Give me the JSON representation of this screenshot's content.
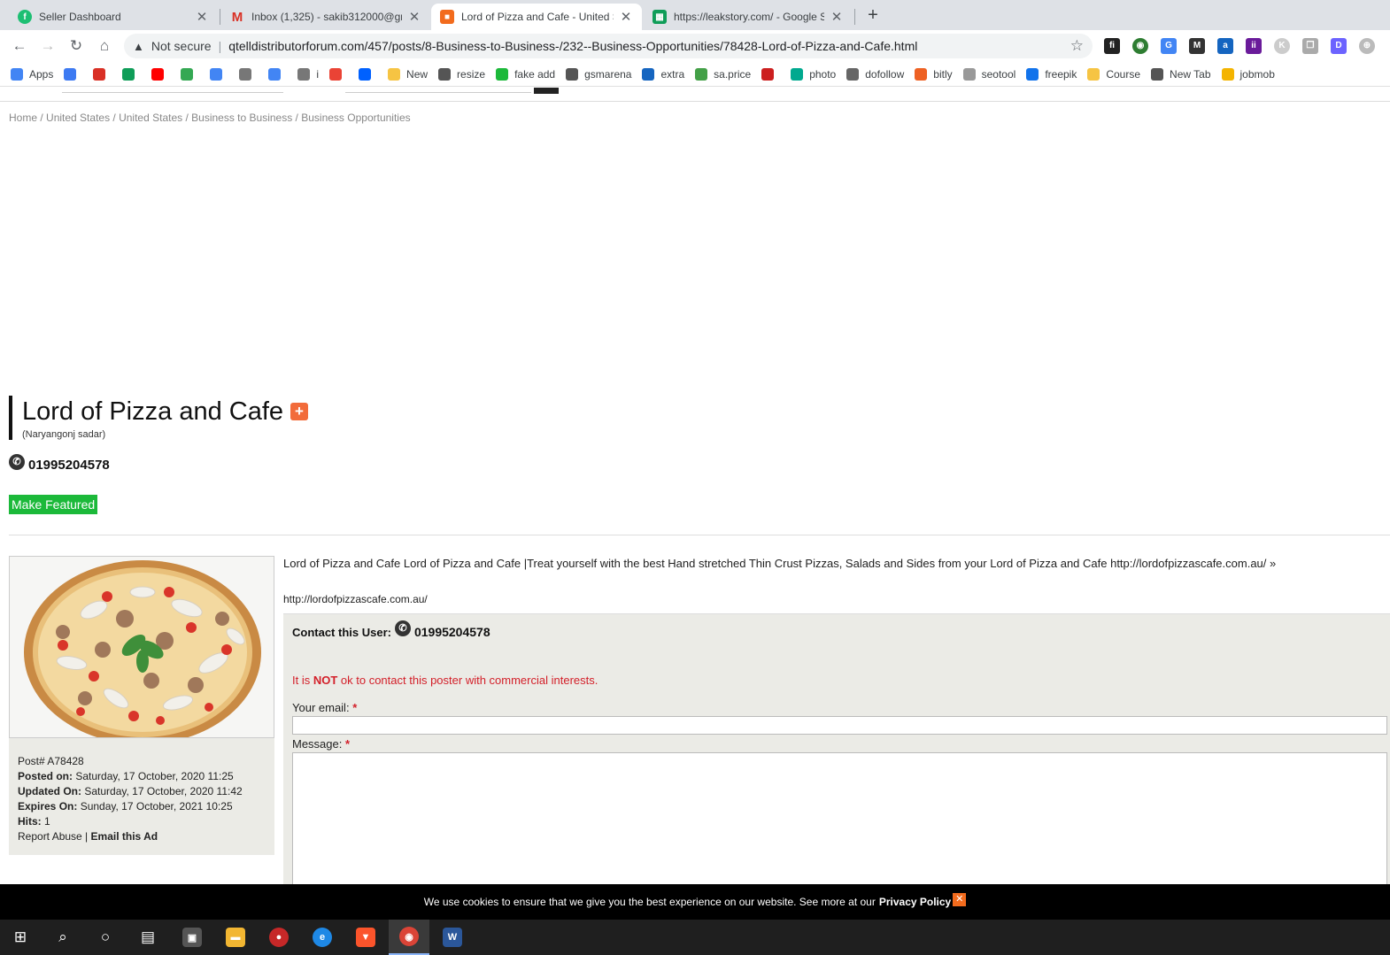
{
  "tabs": [
    {
      "title": "Seller Dashboard",
      "icon": "fiverr-icon",
      "color": "#1dbf73",
      "active": false
    },
    {
      "title": "Inbox (1,325) - sakib312000@gm",
      "icon": "gmail-icon",
      "color": "#d93025",
      "active": false
    },
    {
      "title": "Lord of Pizza and Cafe - United S",
      "icon": "site-icon",
      "color": "#f26b1d",
      "active": true
    },
    {
      "title": "https://leakstory.com/ - Google S",
      "icon": "sheets-icon",
      "color": "#0f9d58",
      "active": false
    }
  ],
  "toolbar": {
    "security_label": "Not secure",
    "url": "qtelldistributorforum.com/457/posts/8-Business-to-Business-/232--Business-Opportunities/78428-Lord-of-Pizza-and-Cafe.html"
  },
  "bookmarks": [
    {
      "label": "Apps",
      "icon": "apps-icon",
      "color": "#4285f4"
    },
    {
      "label": "",
      "icon": "c-icon",
      "color": "#3d7af2"
    },
    {
      "label": "",
      "icon": "gmail-icon",
      "color": "#d93025"
    },
    {
      "label": "",
      "icon": "drive-icon",
      "color": "#0f9d58"
    },
    {
      "label": "",
      "icon": "youtube-icon",
      "color": "#ff0000"
    },
    {
      "label": "",
      "icon": "maps-icon",
      "color": "#34a853"
    },
    {
      "label": "",
      "icon": "docs-icon",
      "color": "#4285f4"
    },
    {
      "label": "",
      "icon": "apple-icon",
      "color": "#777777"
    },
    {
      "label": "",
      "icon": "translate-icon",
      "color": "#4285f4"
    },
    {
      "label": "i",
      "icon": "apple-icon",
      "color": "#777777"
    },
    {
      "label": "",
      "icon": "google-icon",
      "color": "#ea4335"
    },
    {
      "label": "",
      "icon": "dropbox-icon",
      "color": "#0061ff"
    },
    {
      "label": "New",
      "icon": "folder-icon",
      "color": "#f6c443"
    },
    {
      "label": "resize",
      "icon": "globe-icon",
      "color": "#555555"
    },
    {
      "label": "fake add",
      "icon": "map-pin-icon",
      "color": "#1cb93a"
    },
    {
      "label": "gsmarena",
      "icon": "gsmarena-icon",
      "color": "#555555"
    },
    {
      "label": "extra",
      "icon": "extra-icon",
      "color": "#1565c0"
    },
    {
      "label": "sa.price",
      "icon": "leaf-icon",
      "color": "#43a047"
    },
    {
      "label": "",
      "icon": "opera-icon",
      "color": "#cc1f1f"
    },
    {
      "label": "photo",
      "icon": "photo-icon",
      "color": "#00a98f"
    },
    {
      "label": "dofollow",
      "icon": "link-icon",
      "color": "#666666"
    },
    {
      "label": "bitly",
      "icon": "bitly-icon",
      "color": "#ee6123"
    },
    {
      "label": "seotool",
      "icon": "sst-icon",
      "color": "#999999"
    },
    {
      "label": "freepik",
      "icon": "freepik-icon",
      "color": "#1273eb"
    },
    {
      "label": "Course",
      "icon": "folder-icon",
      "color": "#f6c443"
    },
    {
      "label": "New Tab",
      "icon": "globe-icon",
      "color": "#555555"
    },
    {
      "label": "jobmob",
      "icon": "chat-icon",
      "color": "#f4b400"
    }
  ],
  "breadcrumb": [
    "Home",
    "United States",
    "United States",
    "Business to Business",
    "Business Opportunities"
  ],
  "post": {
    "title": "Lord of Pizza and Cafe",
    "location": "(Naryangonj sadar)",
    "phone": "01995204578",
    "featured_label": "Make Featured",
    "description": "Lord of Pizza and Cafe Lord of Pizza and Cafe |Treat yourself with the best Hand stretched Thin Crust Pizzas, Salads and Sides from your Lord of Pizza and Cafe http://lordofpizzascafe.com.au/ »",
    "link": "http://lordofpizzascafe.com.au/"
  },
  "meta": {
    "post_no_label": "Post#",
    "post_no": "A78428",
    "posted_label": "Posted on:",
    "posted": "Saturday, 17 October, 2020  11:25",
    "updated_label": "Updated On:",
    "updated": "Saturday, 17 October, 2020  11:42",
    "expires_label": "Expires On:",
    "expires": "Sunday, 17 October, 2021  10:25",
    "hits_label": "Hits:",
    "hits": "1",
    "report_label": "Report Abuse",
    "email_ad_label": "Email this Ad"
  },
  "contact": {
    "title": "Contact this User:",
    "phone": "01995204578",
    "warning_pre": "It is ",
    "warning_not": "NOT",
    "warning_post": " ok to contact this poster with commercial interests.",
    "email_label": "Your email:",
    "message_label": "Message:",
    "required_mark": "*"
  },
  "cookie": {
    "text": "We use cookies to ensure that we give you the best experience on our website. See more at our",
    "policy_link": "Privacy Policy",
    "close_glyph": "✕"
  },
  "taskbar": {
    "apps": [
      "start-icon",
      "search-icon",
      "cortana-icon",
      "task-view-icon",
      "store-icon",
      "file-explorer-icon",
      "game-icon",
      "edge-icon",
      "brave-icon",
      "chrome-icon",
      "word-icon"
    ]
  }
}
